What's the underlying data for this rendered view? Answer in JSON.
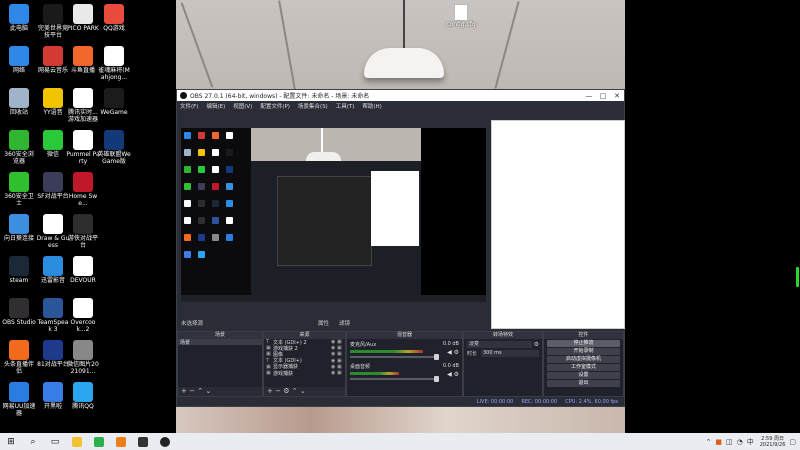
{
  "desktop_icons": [
    {
      "label": "此电脑",
      "color": "#2f88e8"
    },
    {
      "label": "完美世界竞技平台",
      "color": "#1a1a1a"
    },
    {
      "label": "PICO PARK",
      "color": "#e9e9e9"
    },
    {
      "label": "QQ游戏",
      "color": "#e84b3c"
    },
    {
      "label": "网络",
      "color": "#2f88e8"
    },
    {
      "label": "网易云音乐",
      "color": "#d33a31"
    },
    {
      "label": "斗鱼直播",
      "color": "#f2672b"
    },
    {
      "label": "雀魂麻将(Mahjong...",
      "color": "#ffffff"
    },
    {
      "label": "回收站",
      "color": "#9fb4c8"
    },
    {
      "label": "YY语音",
      "color": "#f2c400"
    },
    {
      "label": "腾讯实时...游戏加速器",
      "color": "#ffffff"
    },
    {
      "label": "WeGame",
      "color": "#1b1b1b"
    },
    {
      "label": "360安全浏览器",
      "color": "#2fb52f"
    },
    {
      "label": "微信",
      "color": "#2ac93a"
    },
    {
      "label": "Pummel Party",
      "color": "#ffffff"
    },
    {
      "label": "英雄联盟WeGame版",
      "color": "#123a7a"
    },
    {
      "label": "360安全卫士",
      "color": "#2fbf2f"
    },
    {
      "label": "SF对战平台",
      "color": "#3b3b5a"
    },
    {
      "label": "Home Swe...",
      "color": "#c0182b"
    },
    {
      "label": "",
      "color": "#000000"
    },
    {
      "label": "向日葵连接",
      "color": "#3c8fe0"
    },
    {
      "label": "Draw & Guess",
      "color": "#ffffff"
    },
    {
      "label": "游侠对战平台",
      "color": "#2d2d2d"
    },
    {
      "label": "",
      "color": "#000000"
    },
    {
      "label": "steam",
      "color": "#1b2838"
    },
    {
      "label": "迅雷影音",
      "color": "#2a8de0"
    },
    {
      "label": "DEVOUR",
      "color": "#ffffff"
    },
    {
      "label": "",
      "color": "#000000"
    },
    {
      "label": "OBS Studio",
      "color": "#302e31"
    },
    {
      "label": "TeamSpeak 3",
      "color": "#2a5599"
    },
    {
      "label": "Overcook...2",
      "color": "#ffffff"
    },
    {
      "label": "",
      "color": "#000000"
    },
    {
      "label": "头条直播伴侣",
      "color": "#f26a1b"
    },
    {
      "label": "81对战平台",
      "color": "#1e3a8c"
    },
    {
      "label": "微信图片2021091...",
      "color": "#888888"
    },
    {
      "label": "",
      "color": "#000000"
    },
    {
      "label": "网易UU加速器",
      "color": "#2a7de0"
    },
    {
      "label": "开黑啦",
      "color": "#3a7ce8"
    },
    {
      "label": "腾讯QQ",
      "color": "#2aa5f0"
    },
    {
      "label": "",
      "color": "#000000"
    }
  ],
  "config_icon": {
    "label": "config.cfg"
  },
  "obs": {
    "title": "OBS 27.0.1 (64-bit, windows) - 配置文件: 未命名 - 场景: 未命名",
    "window_buttons": [
      "—",
      "□",
      "✕"
    ],
    "menu": [
      "文件(F)",
      "编辑(E)",
      "视图(V)",
      "配置文件(P)",
      "场景集合(S)",
      "工具(T)",
      "帮助(H)"
    ],
    "status_row": {
      "no_source": "未选择源",
      "properties": "属性",
      "filters": "滤镜"
    },
    "docks": {
      "scenes": {
        "title": "场景",
        "items": [
          "场景"
        ]
      },
      "sources": {
        "title": "来源",
        "items": [
          {
            "type": "T",
            "name": "文本 (GDI+) 2"
          },
          {
            "type": "▣",
            "name": "游戏捕获 2"
          },
          {
            "type": "▣",
            "name": "图像"
          },
          {
            "type": "T",
            "name": "文本 (GDI+)"
          },
          {
            "type": "▣",
            "name": "显示器捕获"
          },
          {
            "type": "▣",
            "name": "游戏捕获"
          }
        ]
      },
      "mixer": {
        "title": "混音器",
        "channels": [
          {
            "name": "麦克风/Aux",
            "db": "0.0 dB",
            "level": 0.82
          },
          {
            "name": "桌面音频",
            "db": "0.0 dB",
            "level": 0.55
          }
        ]
      },
      "transitions": {
        "title": "转场特效",
        "type": "淡变",
        "duration_label": "时长",
        "duration_value": "300 ms"
      },
      "controls": {
        "title": "控件",
        "buttons": [
          "停止推流",
          "开始录制",
          "启动虚拟摄像机",
          "工作室模式",
          "设置",
          "退出"
        ]
      }
    },
    "statusbar": {
      "live": "LIVE: 00:00:00",
      "rec": "REC: 00:00:00",
      "cpu": "CPU: 2.4%, 60.00 fps"
    }
  },
  "taskbar": {
    "start_icon": "windows-icon",
    "clock_time": "2:59 周日",
    "clock_date": "2021/9/26",
    "tray_icons": [
      "chevron-up-icon",
      "network-icon",
      "volume-icon",
      "ime-icon"
    ]
  }
}
